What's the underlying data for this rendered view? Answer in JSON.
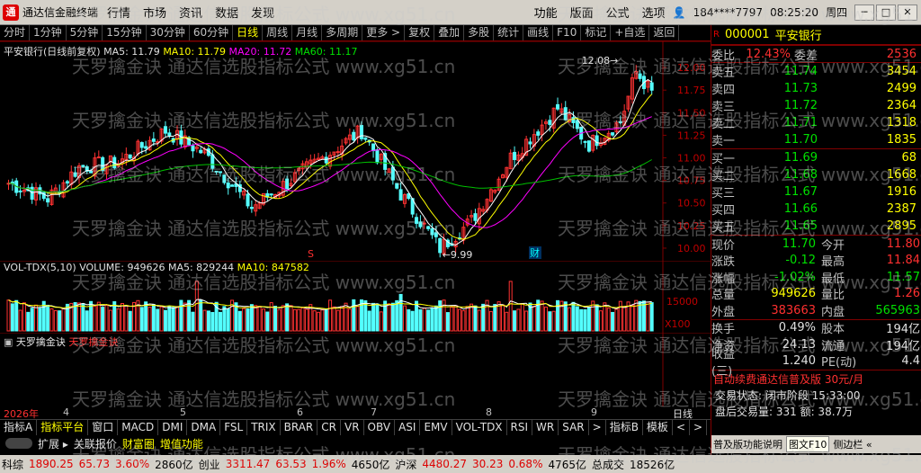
{
  "app": {
    "name": "通达信金融终端",
    "user": "184****7797",
    "time": "08:25:20",
    "weekday": "周四"
  },
  "menu_left": [
    "行情",
    "市场",
    "资讯",
    "数据",
    "发现"
  ],
  "menu_right": [
    "功能",
    "版面",
    "公式",
    "选项"
  ],
  "toolbar": [
    "分时",
    "1分钟",
    "5分钟",
    "15分钟",
    "30分钟",
    "60分钟",
    "日线",
    "周线",
    "月线",
    "多周期",
    "更多 >",
    "复权",
    "叠加",
    "多股",
    "统计",
    "画线",
    "F10",
    "标记",
    "+自选",
    "返回"
  ],
  "chart_title": {
    "name": "平安银行(日线前复权)",
    "ma5": "MA5: 11.79",
    "ma10": "MA10: 11.79",
    "ma20": "MA20: 11.72",
    "ma60": "MA60: 11.17"
  },
  "price_axis": [
    "12.00",
    "11.75",
    "11.50",
    "11.25",
    "11.00",
    "10.75",
    "10.50",
    "10.25",
    "10.00"
  ],
  "annotations": {
    "high": "12.08",
    "low": "9.99",
    "s_marker": "S",
    "cai_marker": "财"
  },
  "vol_legend": {
    "name": "VOL-TDX(5,10)",
    "volume": "VOLUME: 949626",
    "ma5": "MA5: 829244",
    "ma10": "MA10: 847582"
  },
  "vol_axis": [
    "15000",
    "X100"
  ],
  "ind_legend": {
    "name": "天罗擒金诀",
    "sub": "天罗擒金诀"
  },
  "date_axis": [
    "2026年",
    "4",
    "5",
    "6",
    "7",
    "8",
    "9"
  ],
  "date_mode": "日线",
  "bottom_tabs": [
    "指标A",
    "指标平台",
    "窗口",
    "MACD",
    "DMI",
    "DMA",
    "FSL",
    "TRIX",
    "BRAR",
    "CR",
    "VR",
    "OBV",
    "ASI",
    "EMV",
    "VOL-TDX",
    "RSI",
    "WR",
    "SAR",
    ">",
    "指标B",
    "模板",
    "<",
    ">"
  ],
  "bottom_tabs2": [
    "扩展 ▸",
    "关联报价",
    "财富圈",
    "增值功能"
  ],
  "panel": {
    "code": "000001",
    "name": "平安银行",
    "wb_label": "委比",
    "wb_value": "12.43%",
    "wc_label": "委差",
    "wc_value": "2536",
    "sells": [
      [
        "卖五",
        "11.74",
        "3454"
      ],
      [
        "卖四",
        "11.73",
        "2499"
      ],
      [
        "卖三",
        "11.72",
        "2364"
      ],
      [
        "卖二",
        "11.71",
        "1318"
      ],
      [
        "卖一",
        "11.70",
        "1835"
      ]
    ],
    "buys": [
      [
        "买一",
        "11.69",
        "68"
      ],
      [
        "买二",
        "11.68",
        "1668"
      ],
      [
        "买三",
        "11.67",
        "1916"
      ],
      [
        "买四",
        "11.66",
        "2387"
      ],
      [
        "买五",
        "11.65",
        "2895"
      ]
    ],
    "stats": [
      [
        "现价",
        "11.70",
        "今开",
        "11.80"
      ],
      [
        "涨跌",
        "-0.12",
        "最高",
        "11.84"
      ],
      [
        "涨幅",
        "-1.02%",
        "最低",
        "11.57"
      ],
      [
        "总量",
        "949626",
        "量比",
        "1.26"
      ],
      [
        "外盘",
        "383663",
        "内盘",
        "565963"
      ]
    ],
    "stats2": [
      [
        "换手",
        "0.49%",
        "股本",
        "194亿"
      ],
      [
        "净资",
        "24.13",
        "流通",
        "194亿"
      ],
      [
        "收益(三)",
        "1.240",
        "PE(动)",
        "4.4"
      ]
    ],
    "promo": "自动续费通达信普及版 30元/月",
    "trade_status": "交易状态: 闭市阶段  15:33:00",
    "after_vol": "盘后交易量: 331  额: 38.7万",
    "bottom_btns": [
      "笔",
      "价",
      "细",
      "势",
      "联",
      "值",
      "主",
      "筹",
      "逆",
      "主"
    ],
    "help": "普及版功能说明",
    "f10": "图文F10",
    "sidebar": "侧边栏 «"
  },
  "statusbar": {
    "idx1_name": "科综",
    "idx1_val": "1890.25",
    "idx1_chg": "65.73",
    "idx1_pct": "3.60%",
    "idx1_amt": "2860亿",
    "idx2_name": "创业",
    "idx2_val": "3311.47",
    "idx2_chg": "63.53",
    "idx2_pct": "1.96%",
    "idx2_amt": "4650亿",
    "idx3_name": "沪深",
    "idx3_val": "4480.27",
    "idx3_chg": "30.23",
    "idx3_pct": "0.68%",
    "idx3_amt": "4765亿",
    "total_label": "总成交",
    "total_val": "18526亿"
  },
  "watermark": "天罗擒金诀 通达信选股指标公式 www.xg51.cn",
  "chart_data": {
    "type": "candlestick",
    "title": "平安银行(日线前复权)",
    "ylim": [
      9.9,
      12.25
    ],
    "markers": {
      "high": 12.08,
      "low": 9.99
    },
    "ma": {
      "MA5": 11.79,
      "MA10": 11.79,
      "MA20": 11.72,
      "MA60": 11.17
    }
  }
}
